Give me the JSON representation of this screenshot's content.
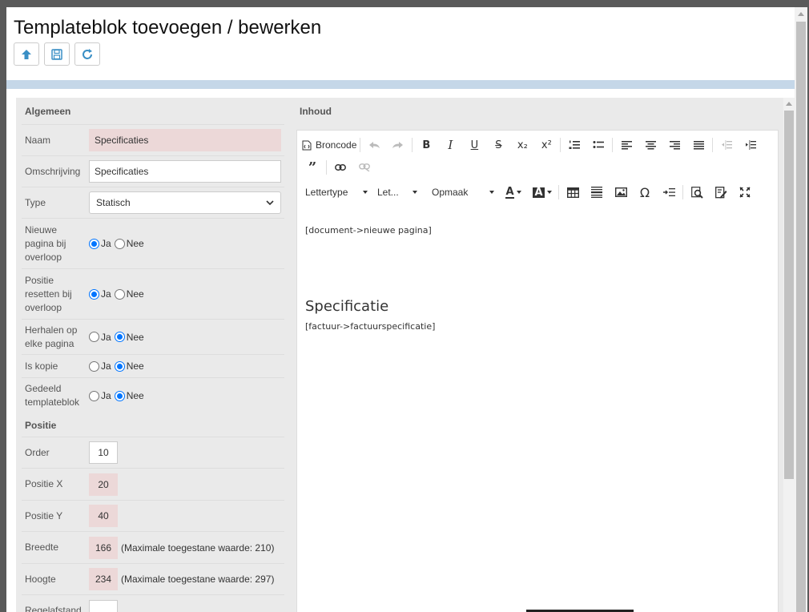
{
  "dialog": {
    "title": "Templateblok toevoegen / bewerken",
    "toolbar": [
      "up-arrow-icon",
      "save-icon",
      "refresh-icon"
    ]
  },
  "left": {
    "section_general": "Algemeen",
    "naam": {
      "label": "Naam",
      "value": "Specificaties"
    },
    "omschrijving": {
      "label": "Omschrijving",
      "value": "Specificaties"
    },
    "type": {
      "label": "Type",
      "value": "Statisch"
    },
    "nieuwe_pagina": {
      "label": "Nieuwe pagina bij overloop",
      "ja": "Ja",
      "nee": "Nee",
      "selected": "Ja"
    },
    "positie_resetten": {
      "label": "Positie resetten bij overloop",
      "ja": "Ja",
      "nee": "Nee",
      "selected": "Ja"
    },
    "herhalen": {
      "label": "Herhalen op elke pagina",
      "ja": "Ja",
      "nee": "Nee",
      "selected": "Nee"
    },
    "is_kopie": {
      "label": "Is kopie",
      "ja": "Ja",
      "nee": "Nee",
      "selected": "Nee"
    },
    "gedeeld": {
      "label": "Gedeeld templateblok",
      "ja": "Ja",
      "nee": "Nee",
      "selected": "Nee"
    },
    "section_position": "Positie",
    "order": {
      "label": "Order",
      "value": "10"
    },
    "positie_x": {
      "label": "Positie X",
      "value": "20"
    },
    "positie_y": {
      "label": "Positie Y",
      "value": "40"
    },
    "breedte": {
      "label": "Breedte",
      "value": "166",
      "hint": "(Maximale toegestane waarde: 210)"
    },
    "hoogte": {
      "label": "Hoogte",
      "value": "234",
      "hint": "(Maximale toegestane waarde: 297)"
    },
    "regelafstand": {
      "label": "Regelafstand",
      "value": ""
    }
  },
  "right": {
    "section_content": "Inhoud",
    "toolbar": {
      "source_label": "Broncode",
      "font_label": "Lettertype",
      "size_label": "Let...",
      "format_label": "Opmaak"
    },
    "document": {
      "line1": "[document->nieuwe pagina]",
      "heading": "Specificatie",
      "line2": "[factuur->factuurspecificatie]"
    }
  }
}
